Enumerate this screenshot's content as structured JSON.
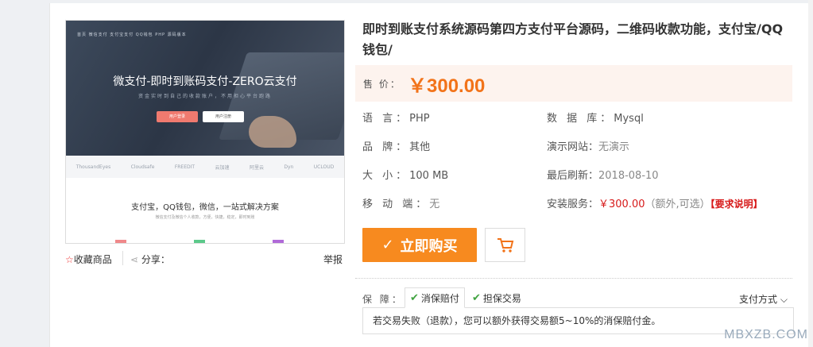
{
  "product_image": {
    "nav_text": "首页   微信支付   支付宝支付   QQ钱包   PHP 源码版本",
    "hero_title": "微支付-即时到账码支付-ZERO云支付",
    "hero_subtitle": "资金实时到自己的收款账户，不用担心平台跑路",
    "hero_btn_primary": "用户登录",
    "hero_btn_secondary": "用户注册",
    "partner_logos": [
      "ThousandEyes",
      "Cloudsafe",
      "FREEDIT",
      "云加速",
      "阿里云",
      "Dyn",
      "UCLOUD"
    ],
    "feature_title": "支付宝，QQ钱包，微信，一站式解决方案",
    "feature_subtitle": "微信支付及微信个人收款，方便，快捷，稳定，即时到账"
  },
  "tools": {
    "favorite": "收藏商品",
    "share": "分享：",
    "report": "举报"
  },
  "title": "即时到账支付系统源码第四方支付平台源码，二维码收款功能，支付宝/QQ钱包/",
  "price": {
    "label": "售 价：",
    "value": "￥300.00"
  },
  "attributes": {
    "language": {
      "label": "语 言：",
      "value": "PHP"
    },
    "database": {
      "label": "数 据 库：",
      "value": "Mysql"
    },
    "brand": {
      "label": "品 牌：",
      "value": "其他"
    },
    "demo": {
      "label": "演示网站：",
      "value": "无演示"
    },
    "size": {
      "label": "大 小：",
      "value": "100 MB"
    },
    "refresh": {
      "label": "最后刷新：",
      "value": "2018-08-10"
    },
    "mobile": {
      "label": "移 动 端：",
      "value": "无"
    },
    "install": {
      "label": "安装服务：",
      "value": "￥300.00",
      "note": "（额外,可选）",
      "link": "【要求说明】"
    }
  },
  "buy_button": "立即购买",
  "guarantee": {
    "label": "保 障：",
    "tabs": [
      "消保赔付",
      "担保交易"
    ],
    "pay_method": "支付方式",
    "text": "若交易失败（退款），您可以额外获得交易额5~10%的消保赔付金。"
  },
  "watermark": "MBXZB.COM",
  "colors": {
    "price": "#f27319",
    "buy": "#f78a1f",
    "link": "#d71a1a",
    "shield": "#3fa33f"
  }
}
